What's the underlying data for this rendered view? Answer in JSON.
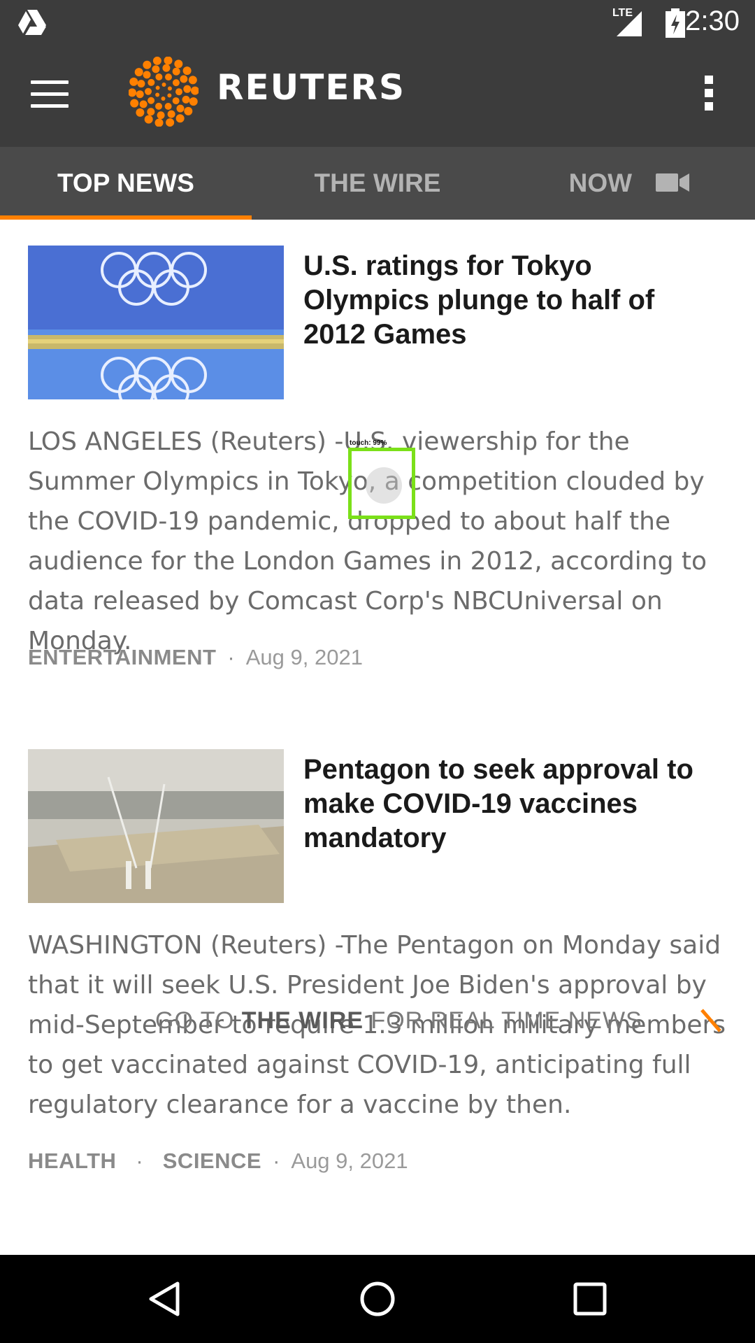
{
  "status_bar": {
    "network": "LTE",
    "time": "2:30"
  },
  "app_bar": {
    "brand": "REUTERS"
  },
  "tabs": [
    {
      "label": "TOP NEWS",
      "active": true
    },
    {
      "label": "THE WIRE",
      "active": false
    },
    {
      "label": "NOW",
      "active": false,
      "icon": "video-camera-icon"
    }
  ],
  "articles": [
    {
      "title": "U.S. ratings for Tokyo Olympics plunge to half of 2012 Games",
      "summary": "LOS ANGELES (Reuters) -U.S. viewership for the Summer Olympics in Tokyo, a competition clouded by the COVID-19 pandemic, dropped to about half the audience for the London Games in 2012, according to data released by Comcast Corp's NBCUniversal on Monday.",
      "tags": [
        "ENTERTAINMENT"
      ],
      "date": "Aug 9, 2021",
      "image": "olympic-rings-photo"
    },
    {
      "title": "Pentagon to seek approval to make COVID-19 vaccines mandatory",
      "summary": "WASHINGTON (Reuters) -The Pentagon on Monday said that it will seek U.S. President Joe Biden's approval by mid-September to require 1.3 million military members to get vaccinated against COVID-19, anticipating full regulatory clearance for a vaccine by then.",
      "tags": [
        "HEALTH",
        "SCIENCE"
      ],
      "date": "Aug 9, 2021",
      "image": "pentagon-aerial-photo"
    }
  ],
  "wire_banner": {
    "prefix": "GO TO ",
    "emphasis": "THE WIRE",
    "suffix": " FOR REAL TIME NEWS"
  },
  "touch_overlay": {
    "label": "touch: 99%"
  },
  "colors": {
    "accent": "#ff8000",
    "bar": "#3c3c3c",
    "tab_bar": "#4a4a4a",
    "touch_box": "#7be019"
  }
}
